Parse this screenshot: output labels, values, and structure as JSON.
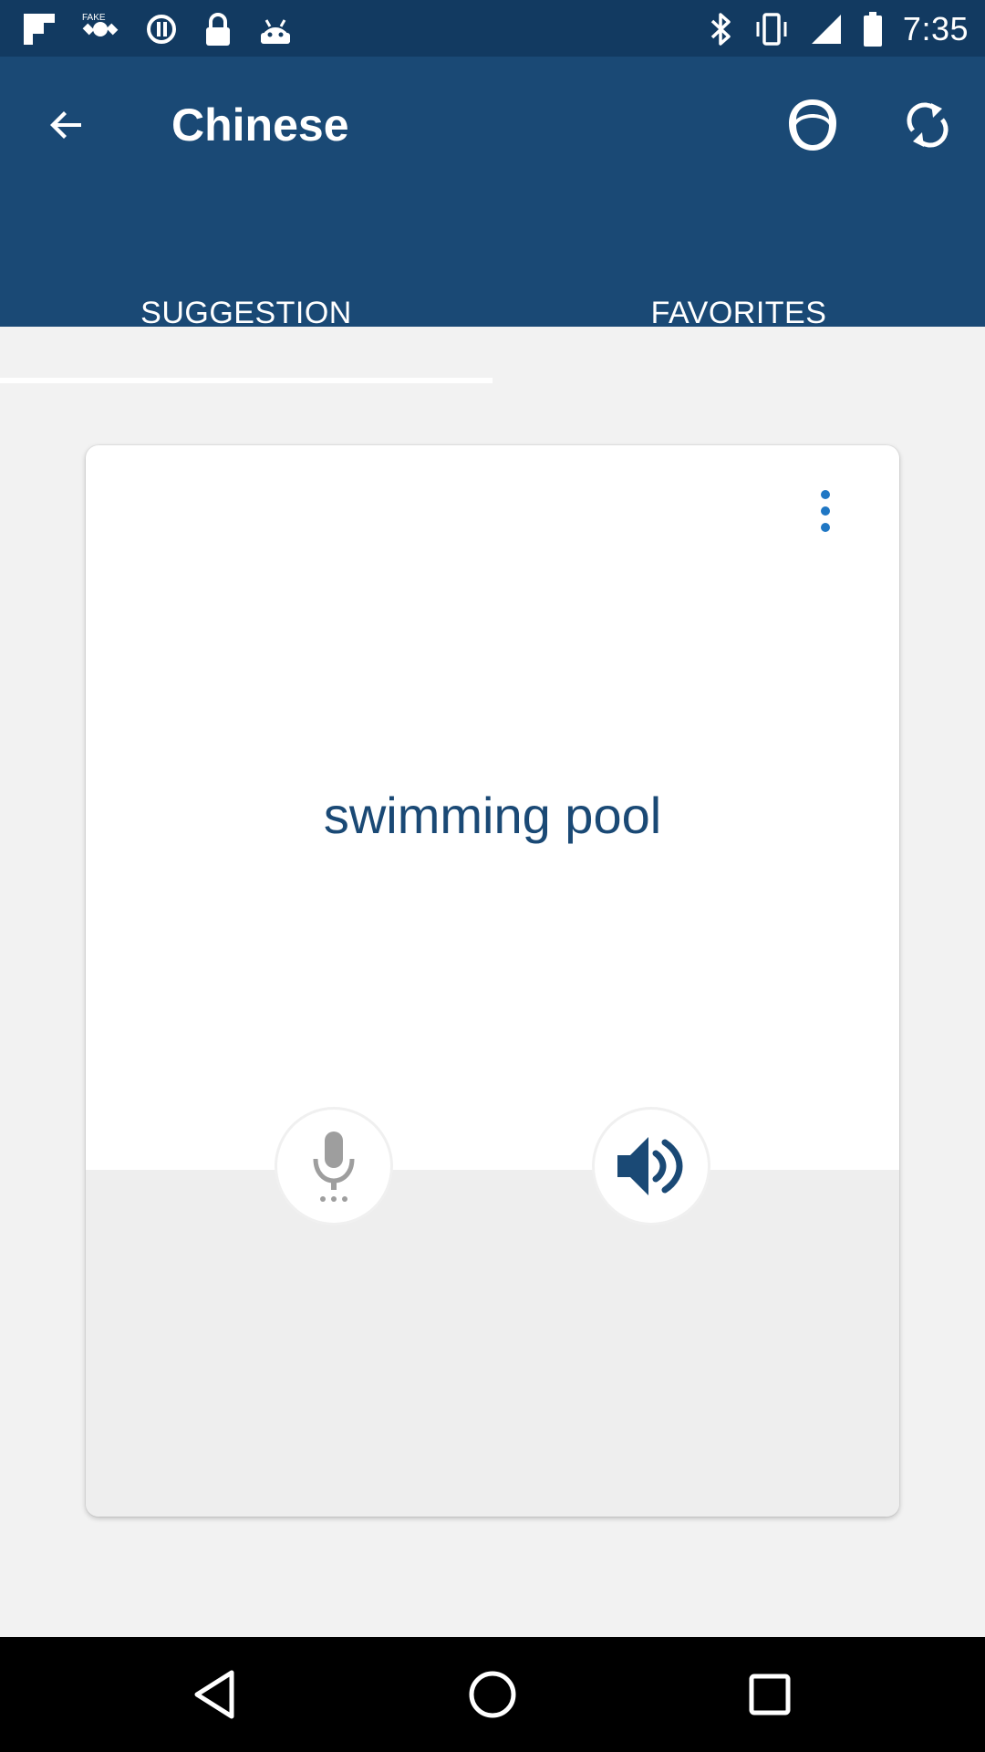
{
  "status_bar": {
    "time": "7:35",
    "left_icons": [
      "flipboard-icon",
      "fake-gps-icon",
      "sync-icon",
      "lock-icon",
      "android-icon"
    ],
    "right_icons": [
      "bluetooth-icon",
      "vibrate-icon",
      "signal-icon",
      "battery-icon"
    ]
  },
  "app_bar": {
    "title": "Chinese",
    "back_icon": "arrow-back-icon",
    "face_icon": "face-icon",
    "refresh_icon": "refresh-icon"
  },
  "tabs": [
    {
      "label": "SUGGESTION",
      "active": true
    },
    {
      "label": "FAVORITES",
      "active": false
    }
  ],
  "card": {
    "phrase": "swimming pool",
    "menu_icon": "more-vertical-icon",
    "mic_icon": "microphone-icon",
    "speaker_icon": "speaker-icon"
  },
  "nav_bar": {
    "icons": [
      "nav-back-icon",
      "nav-home-icon",
      "nav-recent-icon"
    ]
  },
  "colors": {
    "status_bar": "#123a61",
    "app_bar": "#1a4975",
    "accent": "#1f77c4",
    "phrase_text": "#1a4975",
    "background": "#f2f2f2"
  }
}
